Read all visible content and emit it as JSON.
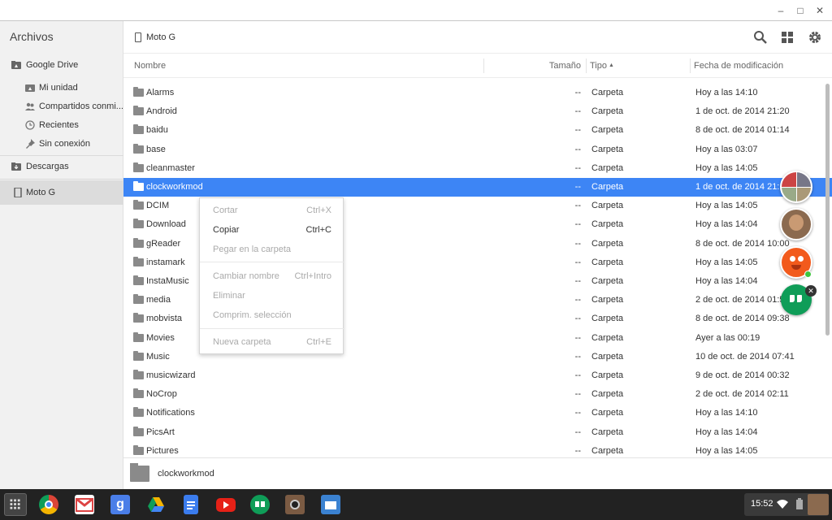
{
  "window": {
    "controls": [
      "minimize",
      "maximize",
      "close"
    ]
  },
  "sidebar": {
    "title": "Archivos",
    "items": [
      {
        "label": "Google Drive",
        "icon": "drive-icon"
      },
      {
        "label": "Mi unidad",
        "icon": "my-drive-icon"
      },
      {
        "label": "Compartidos conmi...",
        "icon": "shared-icon"
      },
      {
        "label": "Recientes",
        "icon": "clock-icon"
      },
      {
        "label": "Sin conexión",
        "icon": "pin-icon"
      },
      {
        "label": "Descargas",
        "icon": "downloads-icon"
      },
      {
        "label": "Moto G",
        "icon": "phone-icon"
      }
    ]
  },
  "toolbar": {
    "breadcrumb": "Moto G",
    "icons": [
      "search-icon",
      "grid-view-icon",
      "gear-icon"
    ]
  },
  "columns": {
    "name": "Nombre",
    "size": "Tamaño",
    "type": "Tipo",
    "sort_arrow": "▲",
    "date": "Fecha de modificación"
  },
  "rows": [
    {
      "name": "Alarms",
      "size": "--",
      "type": "Carpeta",
      "date": "Hoy a las 14:10"
    },
    {
      "name": "Android",
      "size": "--",
      "type": "Carpeta",
      "date": "1 de oct. de 2014 21:20"
    },
    {
      "name": "baidu",
      "size": "--",
      "type": "Carpeta",
      "date": "8 de oct. de 2014 01:14"
    },
    {
      "name": "base",
      "size": "--",
      "type": "Carpeta",
      "date": "Hoy a las 03:07"
    },
    {
      "name": "cleanmaster",
      "size": "--",
      "type": "Carpeta",
      "date": "Hoy a las 14:05"
    },
    {
      "name": "clockworkmod",
      "size": "--",
      "type": "Carpeta",
      "date": "1 de oct. de 2014 21:16",
      "selected": true
    },
    {
      "name": "DCIM",
      "size": "--",
      "type": "Carpeta",
      "date": "Hoy a las 14:05"
    },
    {
      "name": "Download",
      "size": "--",
      "type": "Carpeta",
      "date": "Hoy a las 14:04"
    },
    {
      "name": "gReader",
      "size": "--",
      "type": "Carpeta",
      "date": "8 de oct. de 2014 10:00"
    },
    {
      "name": "instamark",
      "size": "--",
      "type": "Carpeta",
      "date": "Hoy a las 14:05"
    },
    {
      "name": "InstaMusic",
      "size": "--",
      "type": "Carpeta",
      "date": "Hoy a las 14:04"
    },
    {
      "name": "media",
      "size": "--",
      "type": "Carpeta",
      "date": "2 de oct. de 2014 01:53"
    },
    {
      "name": "mobvista",
      "size": "--",
      "type": "Carpeta",
      "date": "8 de oct. de 2014 09:38"
    },
    {
      "name": "Movies",
      "size": "--",
      "type": "Carpeta",
      "date": "Ayer a las 00:19"
    },
    {
      "name": "Music",
      "size": "--",
      "type": "Carpeta",
      "date": "10 de oct. de 2014 07:41"
    },
    {
      "name": "musicwizard",
      "size": "--",
      "type": "Carpeta",
      "date": "9 de oct. de 2014 00:32"
    },
    {
      "name": "NoCrop",
      "size": "--",
      "type": "Carpeta",
      "date": "2 de oct. de 2014 02:11"
    },
    {
      "name": "Notifications",
      "size": "--",
      "type": "Carpeta",
      "date": "Hoy a las 14:10"
    },
    {
      "name": "PicsArt",
      "size": "--",
      "type": "Carpeta",
      "date": "Hoy a las 14:04"
    },
    {
      "name": "Pictures",
      "size": "--",
      "type": "Carpeta",
      "date": "Hoy a las 14:05"
    }
  ],
  "context_menu": {
    "items": [
      {
        "label": "Cortar",
        "shortcut": "Ctrl+X",
        "enabled": false
      },
      {
        "label": "Copiar",
        "shortcut": "Ctrl+C",
        "enabled": true
      },
      {
        "label": "Pegar en la carpeta",
        "shortcut": "",
        "enabled": false
      },
      {
        "label": "Cambiar nombre",
        "shortcut": "Ctrl+Intro",
        "enabled": false
      },
      {
        "label": "Eliminar",
        "shortcut": "",
        "enabled": false
      },
      {
        "label": "Comprim. selección",
        "shortcut": "",
        "enabled": false
      },
      {
        "label": "Nueva carpeta",
        "shortcut": "Ctrl+E",
        "enabled": false
      }
    ]
  },
  "bottom": {
    "selected_name": "clockworkmod"
  },
  "chat_heads": [
    "group-avatar",
    "user-avatar",
    "orange-avatar",
    "hangouts-icon"
  ],
  "shelf": {
    "apps": [
      "launcher-icon",
      "chrome-icon",
      "gmail-icon",
      "google-search-icon",
      "drive-app-icon",
      "docs-icon",
      "youtube-icon",
      "hangouts-app-icon",
      "instagram-icon",
      "files-icon"
    ],
    "clock": "15:52"
  },
  "colors": {
    "selection": "#3d85f5",
    "hangouts": "#0f9d58"
  }
}
